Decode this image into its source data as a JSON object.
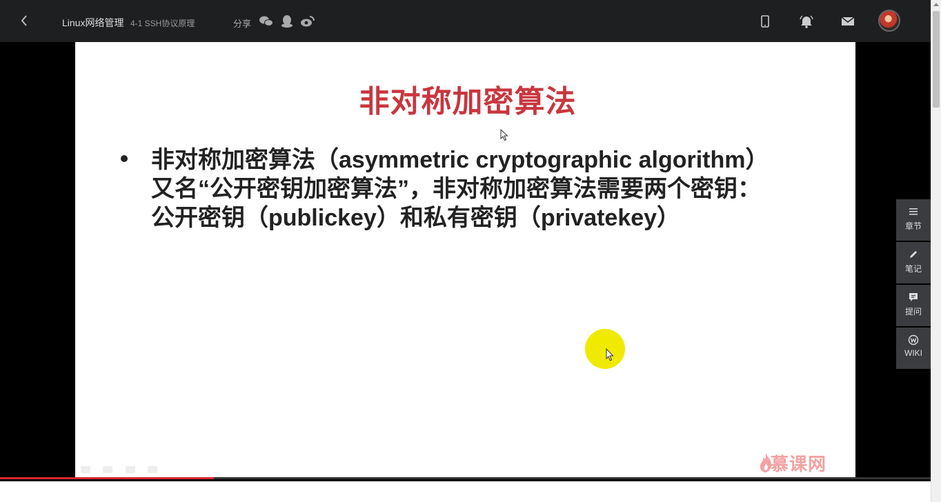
{
  "header": {
    "course_title": "Linux网络管理",
    "lesson_title": "4-1 SSH协议原理",
    "share_label": "分享"
  },
  "slide": {
    "title": "非对称加密算法",
    "bullet_lines": [
      "非对称加密算法（asymmetric cryptographic algorithm）",
      "又名“公开密钥加密算法”，非对称加密算法需要两个密钥：",
      "公开密钥（publickey）和私有密钥（privatekey）"
    ],
    "watermark": "慕课网"
  },
  "side_panel": {
    "chapters": "章节",
    "notes": "笔记",
    "questions": "提问",
    "wiki": "WIKI"
  },
  "player": {
    "progress_fraction": 0.23
  },
  "colors": {
    "title_red": "#c9363e",
    "progress_red": "#d7282f",
    "highlight_yellow": "#f0ea00"
  }
}
